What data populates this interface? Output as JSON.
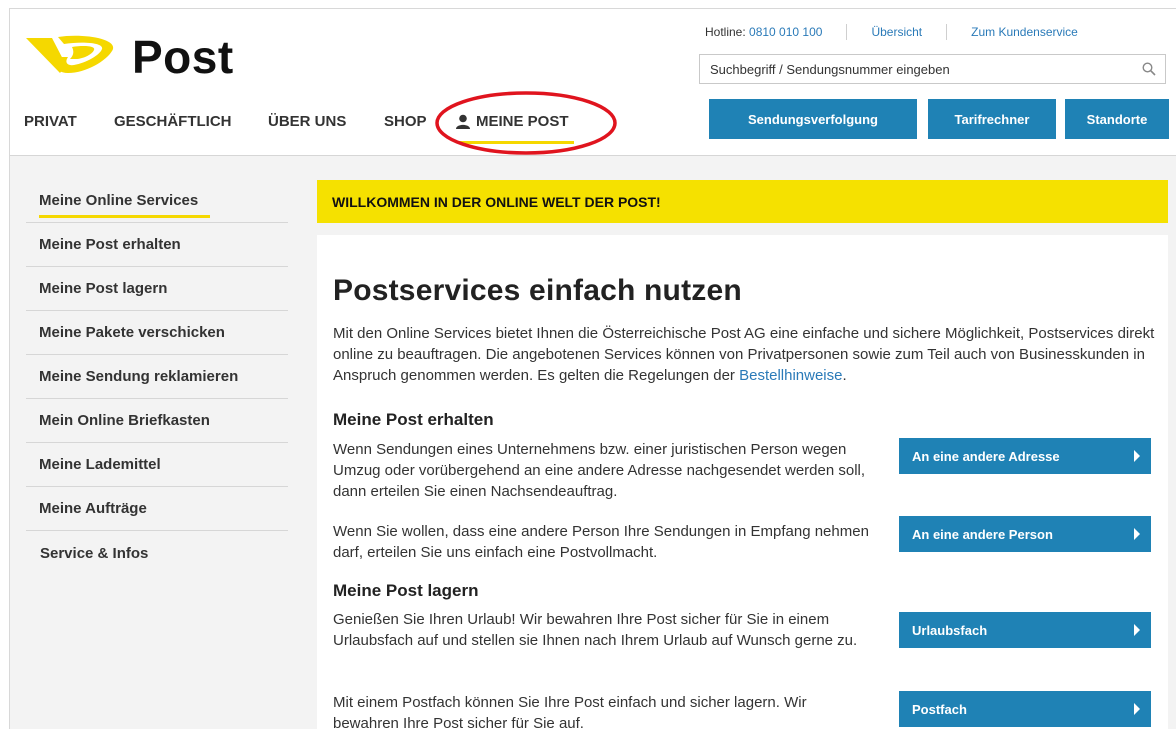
{
  "brand": {
    "name": "Post",
    "yellow": "#f5e100",
    "blue": "#1f82b5",
    "link_blue": "#2a7ab8"
  },
  "toplinks": {
    "hotline_label": "Hotline: ",
    "hotline_number": "0810 010 100",
    "overview": "Übersicht",
    "customer_service": "Zum Kundenservice"
  },
  "search": {
    "placeholder": "Suchbegriff / Sendungsnummer eingeben",
    "icon": "search-icon"
  },
  "nav": {
    "items": [
      "PRIVAT",
      "GESCHÄFTLICH",
      "ÜBER UNS",
      "SHOP"
    ],
    "active": "MEINE POST",
    "active_icon": "user-icon"
  },
  "header_buttons": {
    "tracking": "Sendungsverfolgung",
    "tariff": "Tarifrechner",
    "locations": "Standorte"
  },
  "sidebar": {
    "items": [
      "Meine Online Services",
      "Meine Post erhalten",
      "Meine Post lagern",
      "Meine Pakete verschicken",
      "Meine Sendung reklamieren",
      "Mein Online Briefkasten",
      "Meine Lademittel",
      "Meine Aufträge"
    ],
    "footer_item": "Service & Infos"
  },
  "banner": "WILLKOMMEN IN DER ONLINE WELT DER POST!",
  "main": {
    "title": "Postservices einfach nutzen",
    "intro_before_link": "Mit den Online Services bietet Ihnen die Österreichische Post AG eine einfache und sichere Möglichkeit, Postservices direkt online zu beauftragen. Die angebotenen Services können von Privatpersonen sowie zum Teil auch von Businesskunden in Anspruch genommen werden. Es gelten die Regelungen der ",
    "intro_link": "Bestellhinweise",
    "intro_after_link": ".",
    "sections": [
      {
        "heading": "Meine Post erhalten",
        "rows": [
          {
            "text": "Wenn Sendungen eines Unternehmens bzw. einer juristischen Person wegen Umzug oder vorübergehend an eine andere Adresse nachgesendet werden soll, dann erteilen Sie einen Nachsendeauftrag.",
            "button": "An eine andere Adresse"
          },
          {
            "text": "Wenn Sie wollen, dass eine andere Person Ihre Sendungen in Empfang nehmen darf, erteilen Sie uns einfach eine Postvollmacht.",
            "button": "An eine andere Person"
          }
        ]
      },
      {
        "heading": "Meine Post lagern",
        "rows": [
          {
            "text": "Genießen Sie Ihren Urlaub! Wir bewahren Ihre Post sicher für Sie in einem Urlaubsfach auf und stellen sie Ihnen nach Ihrem Urlaub auf Wunsch gerne zu.",
            "button": "Urlaubsfach"
          },
          {
            "text": "Mit einem Postfach können Sie Ihre Post einfach und sicher lagern. Wir bewahren Ihre Post sicher für Sie auf.",
            "button": "Postfach"
          }
        ]
      }
    ]
  }
}
